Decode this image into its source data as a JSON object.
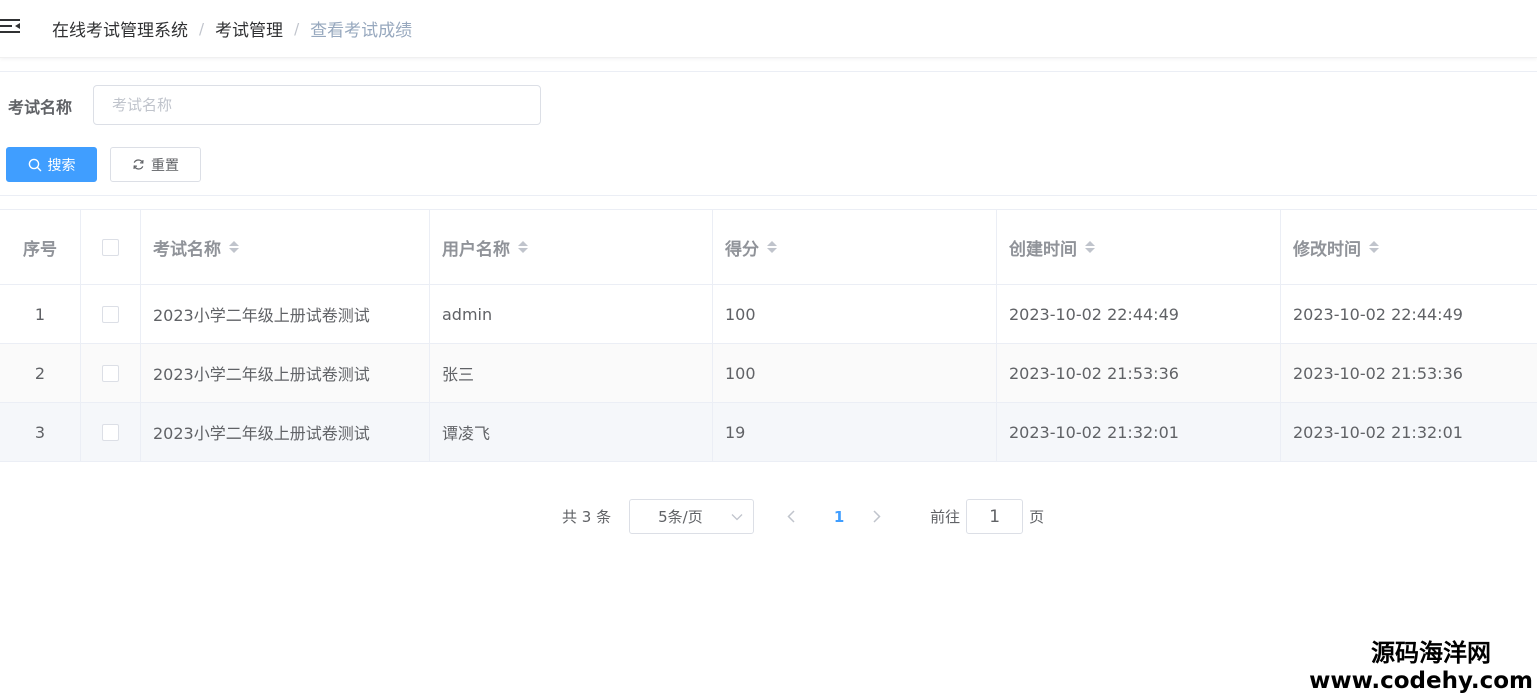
{
  "breadcrumb": {
    "items": [
      "在线考试管理系统",
      "考试管理",
      "查看考试成绩"
    ],
    "separator": "/"
  },
  "search": {
    "label": "考试名称",
    "placeholder": "考试名称",
    "value": ""
  },
  "buttons": {
    "search_label": "搜索",
    "reset_label": "重置"
  },
  "table": {
    "columns": [
      "序号",
      "",
      "考试名称",
      "用户名称",
      "得分",
      "创建时间",
      "修改时间"
    ],
    "rows": [
      {
        "index": "1",
        "exam_name": "2023小学二年级上册试卷测试",
        "user_name": "admin",
        "score": "100",
        "created": "2023-10-02 22:44:49",
        "modified": "2023-10-02 22:44:49"
      },
      {
        "index": "2",
        "exam_name": "2023小学二年级上册试卷测试",
        "user_name": "张三",
        "score": "100",
        "created": "2023-10-02 21:53:36",
        "modified": "2023-10-02 21:53:36"
      },
      {
        "index": "3",
        "exam_name": "2023小学二年级上册试卷测试",
        "user_name": "谭凌飞",
        "score": "19",
        "created": "2023-10-02 21:32:01",
        "modified": "2023-10-02 21:32:01"
      }
    ]
  },
  "pagination": {
    "total_text": "共 3 条",
    "page_size": "5条/页",
    "current_page": "1",
    "goto_label": "前往",
    "goto_value": "1",
    "page_unit": "页"
  },
  "watermark": {
    "text": "源码海洋网",
    "url": "www.codehy.com"
  },
  "colors": {
    "primary": "#409eff",
    "border": "#dcdfe6",
    "text": "#606266",
    "header_text": "#909399"
  },
  "icons": {
    "hamburger": "menu-fold-icon",
    "search": "search-icon",
    "reset": "refresh-icon",
    "sort": "sort-caret-icon",
    "select_arrow": "chevron-down-icon",
    "prev": "chevron-left-icon",
    "next": "chevron-right-icon"
  }
}
